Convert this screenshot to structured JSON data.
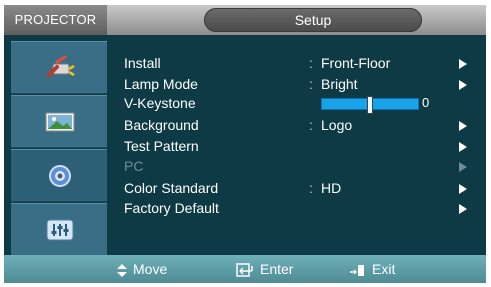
{
  "header": {
    "brand": "PROJECTOR",
    "title": "Setup"
  },
  "sidebar": {
    "items": [
      {
        "icon": "input-plug-icon"
      },
      {
        "icon": "picture-icon"
      },
      {
        "icon": "setup-gear-icon",
        "active": true
      },
      {
        "icon": "equalizer-icon"
      }
    ]
  },
  "menu": {
    "items": [
      {
        "label": "Install",
        "value": "Front-Floor",
        "separator": ":"
      },
      {
        "label": "Lamp Mode",
        "value": "Bright",
        "separator": ":"
      },
      {
        "label": "V-Keystone",
        "slider_value": "0",
        "slider_level": 0.5
      },
      {
        "label": "Background",
        "value": "Logo",
        "separator": ":"
      },
      {
        "label": "Test Pattern"
      },
      {
        "label": "PC",
        "disabled": true
      },
      {
        "label": "Color Standard",
        "value": "HD",
        "separator": ":"
      },
      {
        "label": "Factory Default"
      }
    ]
  },
  "footer": {
    "move": "Move",
    "enter": "Enter",
    "exit": "Exit"
  },
  "colors": {
    "background": "#0d3a44",
    "sidebar_tile": "#3a6e86",
    "slider": "#1aa3e8",
    "footer": "#5f9ea8"
  }
}
